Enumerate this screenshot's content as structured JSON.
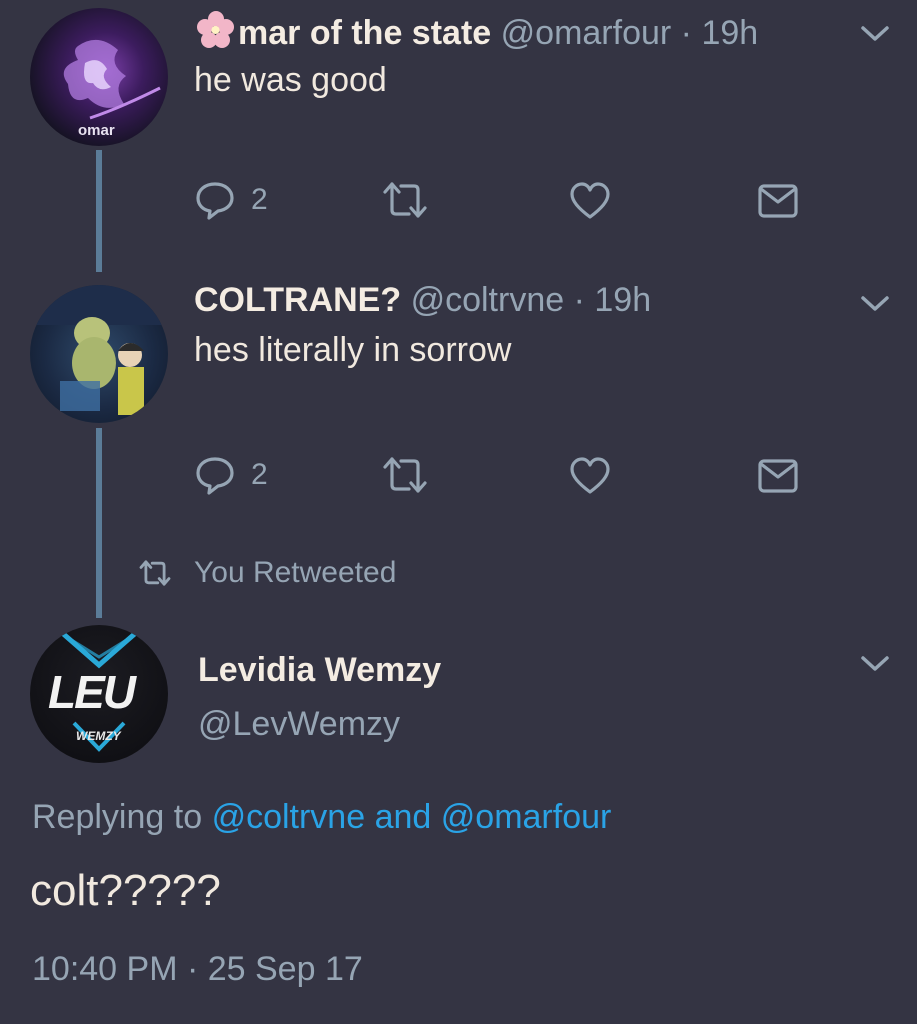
{
  "tweet1": {
    "name": "mar of the state",
    "handle": "@omarfour",
    "time": "19h",
    "text": "he was good",
    "avatar_label": "omar",
    "reply_count": "2"
  },
  "tweet2": {
    "name": "COLTRANE?",
    "handle": "@coltrvne",
    "time": "19h",
    "text": "hes literally in sorrow",
    "reply_count": "2"
  },
  "retweet_note": "You Retweeted",
  "main": {
    "name": "Levidia Wemzy",
    "handle": "@LevWemzy",
    "avatar_logo": "LEU",
    "avatar_label": "WEMZY",
    "replying_prefix": "Replying to",
    "reply_user1": "@coltrvne",
    "reply_and": "and",
    "reply_user2": "@omarfour",
    "text": "colt?????",
    "timestamp": "10:40 PM · 25 Sep 17"
  },
  "separator": "·",
  "colors": {
    "background": "#343443",
    "thread_line": "#5b7c98",
    "link": "#2aa3e6",
    "secondary": "#96a5b4"
  }
}
